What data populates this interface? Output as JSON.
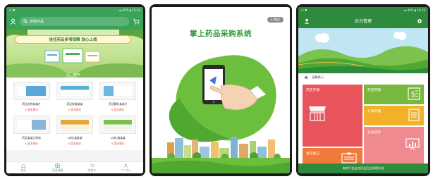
{
  "phone1": {
    "status_left": "☐ ♥",
    "status_right": "· · ⫘ 40% ▮ 10:18",
    "search_placeholder": "搜索药品",
    "banner_title": "信任药品多项保障 放心上线",
    "products": [
      {
        "name": "药品名称某某片",
        "price": "¥ 暂无报价",
        "color": "#5aa8d8"
      },
      {
        "name": "药品胶囊某某",
        "price": "¥ 暂无报价",
        "color": "#56b3d4"
      },
      {
        "name": "药品颗粒某某片",
        "price": "¥ 暂无报价",
        "color": "#6fb6e0"
      },
      {
        "name": "药品某某注射液",
        "price": "¥ 暂无报价",
        "color": "#8ab6d6"
      },
      {
        "name": "10粒/盒某某",
        "price": "¥ 暂无报价",
        "color": "#e3a63a"
      },
      {
        "name": "10粒/盒某某",
        "price": "¥ 暂无报价",
        "color": "#7cbf4f"
      }
    ],
    "tabs": [
      "首页",
      "药品采购",
      "购物车",
      "个人中心"
    ],
    "accent": "#3aa35a"
  },
  "phone2": {
    "skip_label": "1 跳过",
    "title": "掌上药品采购系统",
    "accent": "#2e9b3c"
  },
  "phone3": {
    "status_left": "☐ ♥",
    "status_right": "· ⫘ 40% ▮ 10:19",
    "title": "后台管理",
    "notice": "温馨提示：",
    "tiles": {
      "red": "药店开通",
      "green": "药店管理",
      "yellow": "订单管理",
      "pink": "业务统计",
      "orange": "意见留言"
    },
    "footer": "电商平台业务药品后台管理系统",
    "accent": "#2e8b3e"
  }
}
